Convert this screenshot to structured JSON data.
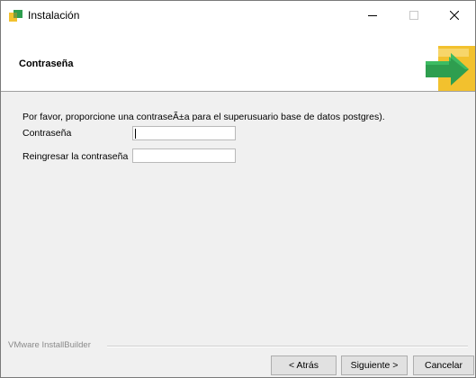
{
  "window": {
    "title": "Instalación",
    "icons": {
      "app": "installer-icon",
      "minimize": "minimize-icon",
      "maximize": "maximize-icon",
      "close": "close-icon"
    }
  },
  "header": {
    "title": "Contraseña",
    "logo_icon": "green-arrow-icon"
  },
  "form": {
    "instruction": "Por favor, proporcione una contraseÃ±a para el superusuario base de datos postgres).",
    "password_label": "Contraseña",
    "password_value": "",
    "confirm_label": "Reingresar la contraseña",
    "confirm_value": ""
  },
  "footer": {
    "brand": "VMware InstallBuilder",
    "back_label": "< Atrás",
    "next_label": "Siguiente >",
    "cancel_label": "Cancelar"
  },
  "colors": {
    "logo_green": "#2e9e4f",
    "logo_yellow": "#f2c12e"
  }
}
